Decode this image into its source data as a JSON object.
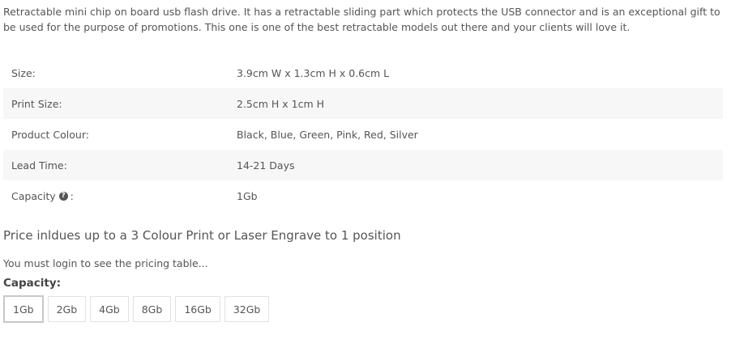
{
  "description": "Retractable mini chip on board usb flash drive. It has a retractable sliding part which protects the USB connector and is an exceptional gift to be used for the purpose of promotions. This one is one of the best retractable models out there and your clients will love it.",
  "specs": [
    {
      "label": "Size:",
      "value": "3.9cm W x 1.3cm H x 0.6cm L"
    },
    {
      "label": "Print Size:",
      "value": "2.5cm H x 1cm H"
    },
    {
      "label": "Product Colour:",
      "value": "Black, Blue, Green, Pink, Red, Silver"
    },
    {
      "label": "Lead Time:",
      "value": "14-21 Days"
    },
    {
      "label": "Capacity",
      "suffix": ":",
      "value": "1Gb"
    }
  ],
  "price_note": "Price inldues up to a 3 Colour Print or Laser Engrave to 1 position",
  "login_note": "You must login to see the pricing table...",
  "capacity": {
    "heading": "Capacity:",
    "options": [
      "1Gb",
      "2Gb",
      "4Gb",
      "8Gb",
      "16Gb",
      "32Gb"
    ],
    "selected": "1Gb"
  },
  "icons": {
    "help": "question-circle-icon"
  },
  "colors": {
    "text": "#555555",
    "row_alt": "#f7f7f7",
    "border": "#e2e2e2"
  }
}
